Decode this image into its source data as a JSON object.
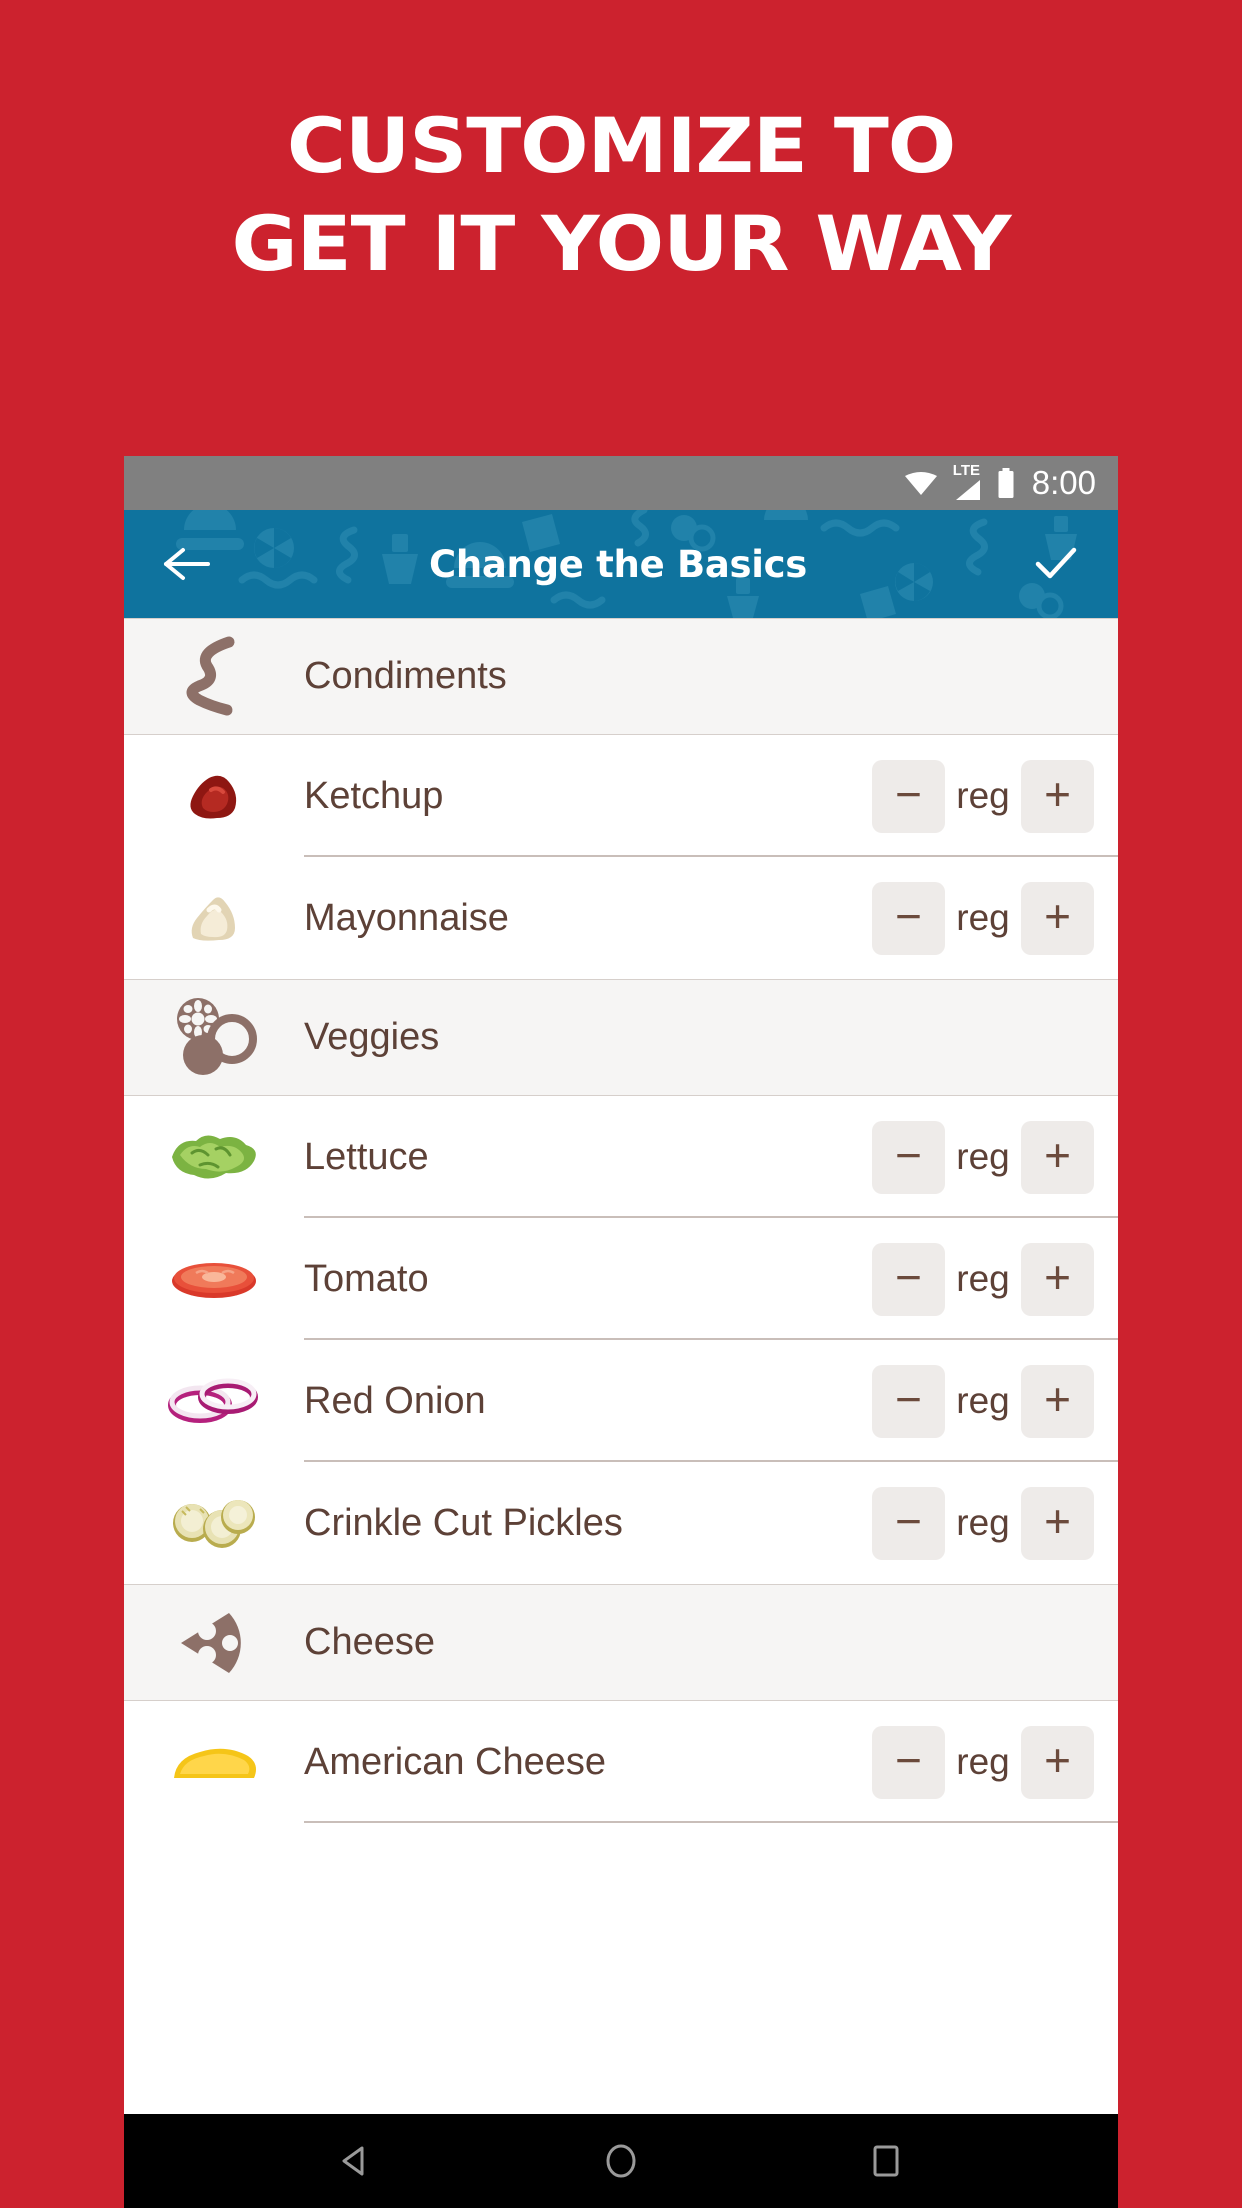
{
  "promo": {
    "line1": "CUSTOMIZE TO",
    "line2": "GET IT YOUR WAY",
    "bg_color": "#cc222e",
    "text_color": "#ffffff"
  },
  "statusbar": {
    "wifi_icon": "wifi-icon",
    "network_label": "LTE",
    "signal_icon": "signal-bars-icon",
    "battery_icon": "battery-full-icon",
    "time": "8:00",
    "bg_color": "#808080"
  },
  "appbar": {
    "back_icon": "back-arrow-icon",
    "title": "Change the Basics",
    "confirm_icon": "checkmark-icon",
    "bg_color": "#0f739e"
  },
  "stepper": {
    "minus_label": "−",
    "plus_label": "+"
  },
  "sections": [
    {
      "label": "Condiments",
      "icon": "sauce-squiggle-icon",
      "items": [
        {
          "name": "Ketchup",
          "thumb": "ketchup-dollop-image",
          "value": "reg"
        },
        {
          "name": "Mayonnaise",
          "thumb": "mayonnaise-dollop-image",
          "value": "reg"
        }
      ]
    },
    {
      "label": "Veggies",
      "icon": "veggies-icon",
      "items": [
        {
          "name": "Lettuce",
          "thumb": "lettuce-leaf-image",
          "value": "reg"
        },
        {
          "name": "Tomato",
          "thumb": "tomato-slice-image",
          "value": "reg"
        },
        {
          "name": "Red Onion",
          "thumb": "red-onion-rings-image",
          "value": "reg"
        },
        {
          "name": "Crinkle Cut Pickles",
          "thumb": "pickle-slices-image",
          "value": "reg"
        }
      ]
    },
    {
      "label": "Cheese",
      "icon": "cheese-wedge-icon",
      "items": [
        {
          "name": "American Cheese",
          "thumb": "american-cheese-image",
          "value": "reg"
        }
      ]
    }
  ],
  "navbar": {
    "back_icon": "android-back-icon",
    "home_icon": "android-home-icon",
    "recents_icon": "android-recents-icon",
    "bg_color": "#000000"
  }
}
